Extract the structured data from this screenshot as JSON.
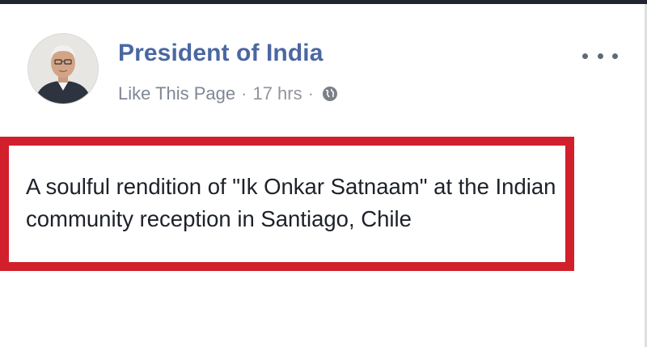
{
  "post": {
    "page_name": "President of India",
    "like_label": "Like This Page",
    "separator": "·",
    "time": "17 hrs",
    "privacy_icon": "globe-icon",
    "more_icon": "more-options-icon",
    "text": "A soulful rendition of \"Ik Onkar Satnaam\" at the Indian community reception in Santiago, Chile"
  },
  "colors": {
    "page_name": "#4b67a1",
    "meta_text": "#90949c",
    "highlight_border": "#d21f2c",
    "body_text": "#1d2129"
  }
}
